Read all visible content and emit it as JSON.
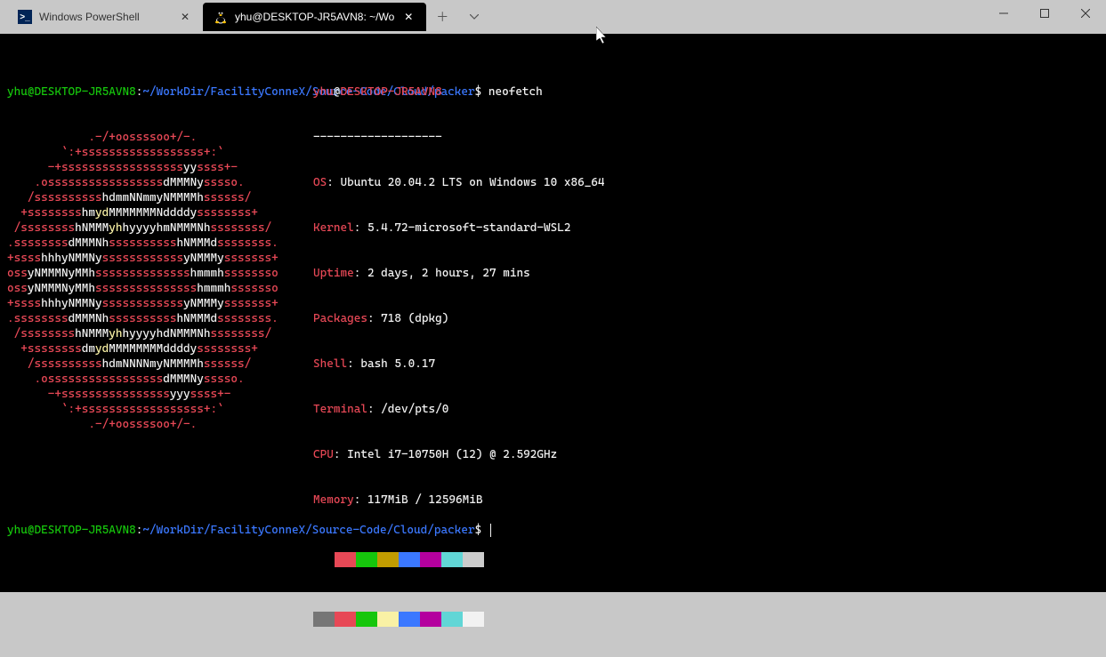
{
  "tabs": {
    "inactive_label": "Windows PowerShell",
    "active_label": "yhu@DESKTOP-JR5AVN8: ~/Wo"
  },
  "prompt1": {
    "userhost": "yhu@DESKTOP-JR5AVN8",
    "colon": ":",
    "path": "~/WorkDir/FacilityConneX/Source-Code/Cloud/packer",
    "sign": "$ ",
    "cmd": "neofetch"
  },
  "prompt2": {
    "userhost": "yhu@DESKTOP-JR5AVN8",
    "colon": ":",
    "path": "~/WorkDir/FacilityConneX/Source-Code/Cloud/packer",
    "sign": "$ "
  },
  "info": {
    "user": "yhu",
    "at": "@",
    "host": "DESKTOP-JR5AVN8",
    "divider": "-------------------",
    "os_k": "OS",
    "os_v": ": Ubuntu 20.04.2 LTS on Windows 10 x86_64",
    "kernel_k": "Kernel",
    "kernel_v": ": 5.4.72-microsoft-standard-WSL2",
    "uptime_k": "Uptime",
    "uptime_v": ": 2 days, 2 hours, 27 mins",
    "packages_k": "Packages",
    "packages_v": ": 718 (dpkg)",
    "shell_k": "Shell",
    "shell_v": ": bash 5.0.17",
    "terminal_k": "Terminal",
    "terminal_v": ": /dev/pts/0",
    "cpu_k": "CPU",
    "cpu_v": ": Intel i7-10750H (12) @ 2.592GHz",
    "memory_k": "Memory",
    "memory_v": ": 117MiB / 12596MiB"
  },
  "swatches": {
    "row1": [
      "#000000",
      "#e74856",
      "#16c60c",
      "#c19c00",
      "#3b78ff",
      "#b4009e",
      "#61d6d6",
      "#cccccc"
    ],
    "row2": [
      "#767676",
      "#e74856",
      "#16c60c",
      "#f9f1a5",
      "#3b78ff",
      "#b4009e",
      "#61d6d6",
      "#f2f2f2"
    ]
  },
  "logo": [
    {
      "red": "            .-/+oossssoo+/-.",
      "wh": ""
    },
    {
      "red": "        `:+ssssssssssssssssss+:`",
      "wh": ""
    },
    {
      "red": "      -+ssssssssssssssssss",
      "wh": "yy",
      "red2": "ssss+-"
    },
    {
      "red": "    .osssssssssssssssss",
      "wh": "dMMMNy",
      "red2": "sssso."
    },
    {
      "red": "   /ssssssssss",
      "wh": "hdmmNNmmyNMMMMh",
      "red2": "ssssss/"
    },
    {
      "red": "  +ssssssss",
      "wh": "hm",
      "yd": "yd",
      "wh2": "MMMMMMMNddddy",
      "red2": "ssssssss+"
    },
    {
      "red": " /ssssssss",
      "wh": "hNMMM",
      "yd": "yh",
      "wh2": "hyyyyhmNMMMNh",
      "red2": "ssssssss/"
    },
    {
      "red": ".ssssssss",
      "wh": "dMMMNh",
      "red2": "ssssssssss",
      "wh3": "hNMMMd",
      "red3": "ssssssss."
    },
    {
      "red": "+ssss",
      "wh": "hhhyNMMNy",
      "red2": "ssssssssssss",
      "wh3": "yNMMMy",
      "red3": "sssssss+"
    },
    {
      "red": "oss",
      "wh": "yNMMMNyMMh",
      "red2": "ssssssssssssss",
      "wh3": "hmmmh",
      "red3": "ssssssso"
    },
    {
      "red": "oss",
      "wh": "yNMMMNyMMh",
      "red2": "sssssssssssssss",
      "wh3": "hmmmh",
      "red3": "sssssso"
    },
    {
      "red": "+ssss",
      "wh": "hhhyNMMNy",
      "red2": "ssssssssssss",
      "wh3": "yNMMMy",
      "red3": "sssssss+"
    },
    {
      "red": ".ssssssss",
      "wh": "dMMMNh",
      "red2": "ssssssssss",
      "wh3": "hNMMMd",
      "red3": "ssssssss."
    },
    {
      "red": " /ssssssss",
      "wh": "hNMMM",
      "yd": "yh",
      "wh2": "hyyyyhdNMMMNh",
      "red2": "ssssssss/"
    },
    {
      "red": "  +ssssssss",
      "wh": "dm",
      "yd": "yd",
      "wh2": "MMMMMMMMddddy",
      "red2": "ssssssss+"
    },
    {
      "red": "   /ssssssssss",
      "wh": "hdmNNNNmyNMMMMh",
      "red2": "ssssss/"
    },
    {
      "red": "    .osssssssssssssssss",
      "wh": "dMMMNy",
      "red2": "sssso."
    },
    {
      "red": "      -+ssssssssssssssss",
      "wh": "yyy",
      "red2": "ssss+-"
    },
    {
      "red": "        `:+ssssssssssssssssss+:`",
      "wh": ""
    },
    {
      "red": "            .-/+oossssoo+/-.",
      "wh": ""
    }
  ]
}
